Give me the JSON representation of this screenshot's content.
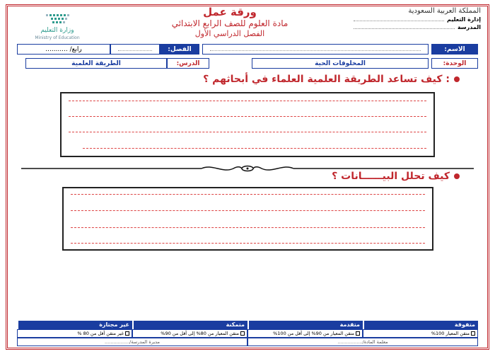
{
  "header": {
    "ministry_ar": "وزارة التعليم",
    "ministry_en": "Ministry of Education",
    "title": "ورقة عمل",
    "subject": "مادة العلوم للصف الرابع الابتدائي",
    "semester": "الفصل الدراسي الأول",
    "kingdom": "المملكة العربية السعودية",
    "education_admin_label": "إدارة التعليم",
    "school_label": "المدرسة"
  },
  "info_row1": {
    "name_label": "الاسم:",
    "class_label": "الفصل:",
    "class_value": "رابع/ ..........."
  },
  "info_row2": {
    "unit_label": "الوحدة:",
    "unit_value": "المخلوقات الحية",
    "lesson_label": "الدرس:",
    "lesson_value": "الطريقة العلمية"
  },
  "questions": [
    {
      "text": ": كيف تساعد الطريقة العلمية العلماء في أبحاثهم ؟"
    },
    {
      "text": "كيف تحلل البيــــــانات ؟"
    }
  ],
  "grades": {
    "headers": [
      "متفوقة",
      "متقدمة",
      "متمكنة",
      "غير مجتازة"
    ],
    "criteria": [
      "متقن المعيار 100%",
      "متقن المعيار من 90% إلى أقل من 100%",
      "متقن المعيار من 80% إلى أقل من 90%",
      "غير متقن أقل من 80 %"
    ],
    "teacher_label": "معلمة المادة/.................",
    "principal_label": "مديرة المدرسة/................."
  },
  "colors": {
    "red": "#c0272d",
    "blue": "#1a3da0",
    "teal": "#2f9c8e"
  }
}
